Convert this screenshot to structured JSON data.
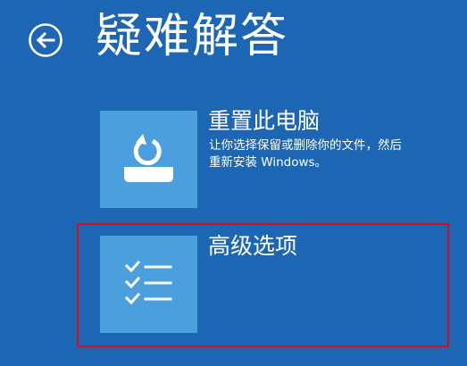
{
  "header": {
    "title": "疑难解答",
    "back_icon": "back-arrow-icon"
  },
  "options": [
    {
      "title": "重置此电脑",
      "description_lines": [
        "让你选择保留或删除你的文件，然后",
        "重新安装 Windows。"
      ],
      "icon": "reset-pc-icon"
    },
    {
      "title": "高级选项",
      "description_lines": [],
      "icon": "checklist-icon"
    }
  ],
  "colors": {
    "background": "#1d66b4",
    "tile": "#4a9fdc",
    "highlight": "#d0101e"
  }
}
